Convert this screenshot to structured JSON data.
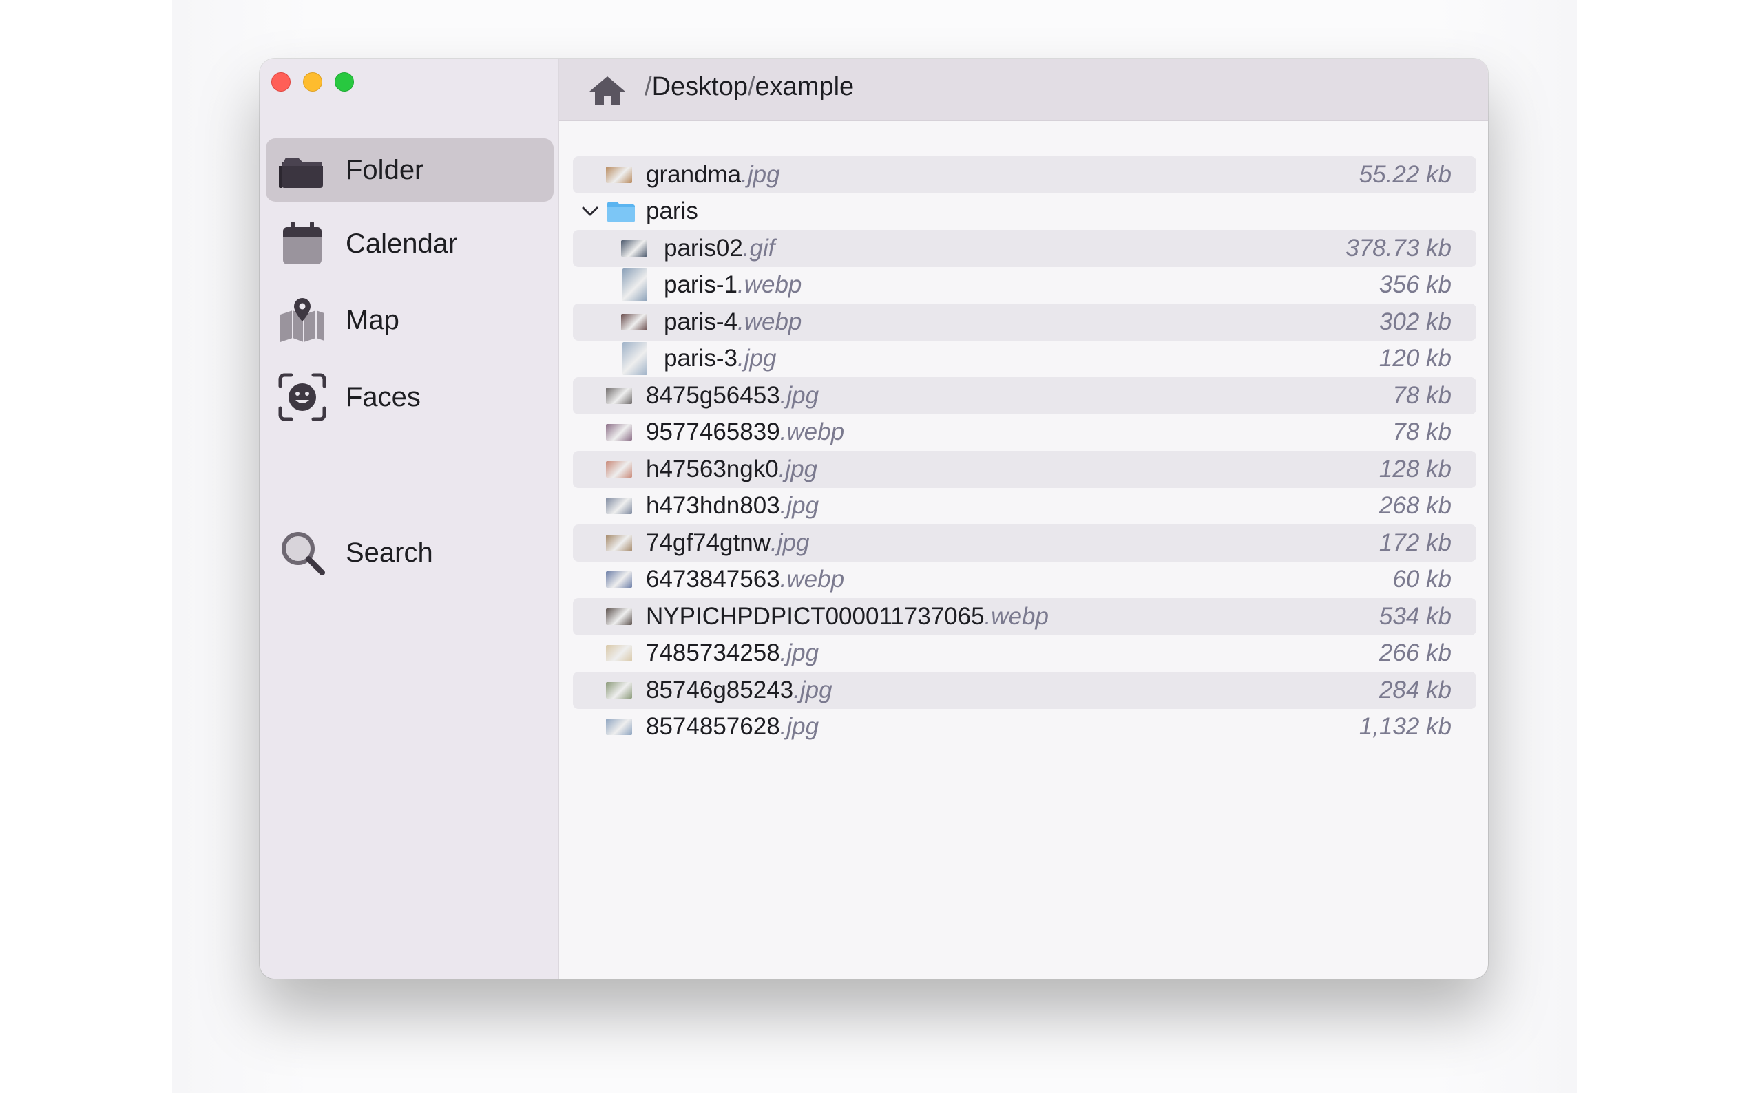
{
  "window": {
    "controls": [
      "close",
      "minimize",
      "zoom"
    ]
  },
  "sidebar": {
    "items": [
      {
        "label": "Folder",
        "icon": "folder-icon",
        "active": true
      },
      {
        "label": "Calendar",
        "icon": "calendar-icon",
        "active": false
      },
      {
        "label": "Map",
        "icon": "map-icon",
        "active": false
      },
      {
        "label": "Faces",
        "icon": "face-scan-icon",
        "active": false
      },
      {
        "label": "Search",
        "icon": "search-icon",
        "active": false
      }
    ]
  },
  "header": {
    "home_icon": "home-icon",
    "path_sep1": "/",
    "path_part1": "Desktop",
    "path_sep2": "/",
    "path_part2": "example"
  },
  "files": [
    {
      "name": "grandma",
      "ext": ".jpg",
      "size": "55.22 kb",
      "indent": 0,
      "thumb": "#b88a5e"
    },
    {
      "name": "paris",
      "ext": "",
      "size": "",
      "indent": 0,
      "folder": true,
      "expanded": true
    },
    {
      "name": "paris02",
      "ext": ".gif",
      "size": "378.73 kb",
      "indent": 1,
      "thumb": "#4d5a6e"
    },
    {
      "name": "paris-1",
      "ext": ".webp",
      "size": "356 kb",
      "indent": 1,
      "thumb": "#8aa0b8",
      "tall": true
    },
    {
      "name": "paris-4",
      "ext": ".webp",
      "size": "302 kb",
      "indent": 1,
      "thumb": "#6b4e4e"
    },
    {
      "name": "paris-3",
      "ext": ".jpg",
      "size": "120 kb",
      "indent": 1,
      "thumb": "#9fb2c8",
      "tall": true
    },
    {
      "name": "8475g56453",
      "ext": ".jpg",
      "size": "78 kb",
      "indent": 0,
      "thumb": "#6e6a6a"
    },
    {
      "name": "9577465839",
      "ext": ".webp",
      "size": "78 kb",
      "indent": 0,
      "thumb": "#8c6f88"
    },
    {
      "name": "h47563ngk0",
      "ext": ".jpg",
      "size": "128 kb",
      "indent": 0,
      "thumb": "#c98a7a"
    },
    {
      "name": "h473hdn803",
      "ext": ".jpg",
      "size": "268 kb",
      "indent": 0,
      "thumb": "#7f8aa0"
    },
    {
      "name": "74gf74gtnw",
      "ext": ".jpg",
      "size": "172 kb",
      "indent": 0,
      "thumb": "#a5896a"
    },
    {
      "name": "6473847563",
      "ext": ".webp",
      "size": "60 kb",
      "indent": 0,
      "thumb": "#6e7fa8"
    },
    {
      "name": "NYPICHPDPICT000011737065",
      "ext": ".webp",
      "size": "534 kb",
      "indent": 0,
      "thumb": "#5e5450"
    },
    {
      "name": "7485734258",
      "ext": ".jpg",
      "size": "266 kb",
      "indent": 0,
      "thumb": "#d9c8a8"
    },
    {
      "name": "85746g85243",
      "ext": ".jpg",
      "size": "284 kb",
      "indent": 0,
      "thumb": "#8b9a7a"
    },
    {
      "name": "8574857628",
      "ext": ".jpg",
      "size": "1,132 kb",
      "indent": 0,
      "thumb": "#8ea4c0"
    }
  ]
}
